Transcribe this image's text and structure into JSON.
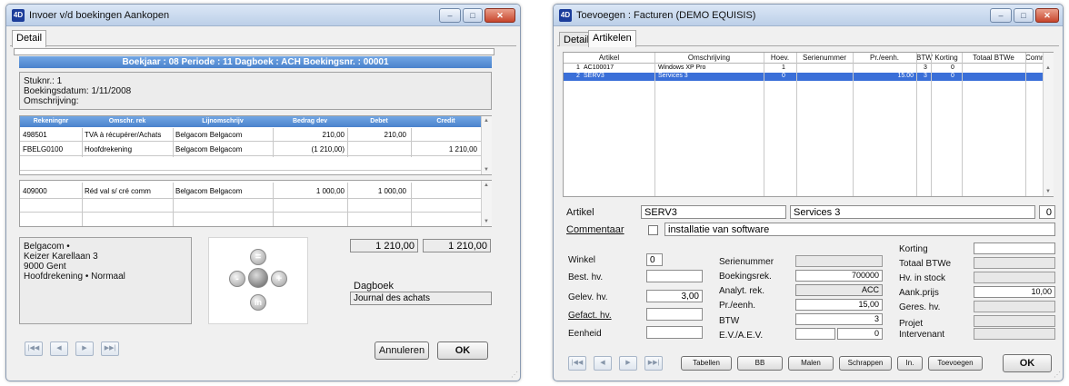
{
  "left_window": {
    "title": "Invoer v/d boekingen Aankopen",
    "tab_detail": "Detail",
    "header_bar": "Boekjaar : 08 Periode : 11 Dagboek : ACH  Boekingsnr. : 00001",
    "info": {
      "stuknr": "Stuknr.: 1",
      "datum": "Boekingsdatum: 1/11/2008",
      "omschrijving": "Omschrijving:"
    },
    "grid_headers": [
      "Rekeningnr",
      "Omschr. rek",
      "Lijnomschrijv",
      "Bedrag dev",
      "Debet",
      "Credit"
    ],
    "grid_rows": [
      {
        "rek": "498501",
        "omschr": "TVA à récupérer/Achats",
        "lijn": "Belgacom Belgacom",
        "dev": "210,00",
        "debet": "210,00",
        "credit": ""
      },
      {
        "rek": "FBELG0100",
        "omschr": "Hoofdrekening",
        "lijn": "Belgacom Belgacom",
        "dev": "(1 210,00)",
        "debet": "",
        "credit": "1 210,00"
      }
    ],
    "grid2_rows": [
      {
        "rek": "409000",
        "omschr": "Réd val s/ cré comm",
        "lijn": "Belgacom Belgacom",
        "dev": "1 000,00",
        "debet": "1 000,00",
        "credit": ""
      }
    ],
    "address": {
      "line1": "Belgacom •",
      "line2": "Keizer Karellaan 3",
      "line3": "9000  Gent",
      "line4": "Hoofdrekening • Normaal"
    },
    "total_debet": "1 210,00",
    "total_credit": "1 210,00",
    "dagboek_label": "Dagboek",
    "dagboek_value": "Journal des achats",
    "dial": {
      "top": "=",
      "left": "-",
      "right": "+",
      "bottom": "in"
    },
    "nav": {
      "first": "|◀◀",
      "prev": "◀",
      "next": "▶",
      "last": "▶▶|"
    },
    "btn_cancel": "Annuleren",
    "btn_ok": "OK"
  },
  "right_window": {
    "title": "Toevoegen : Facturen (DEMO EQUISIS)",
    "tab_detail": "Detail",
    "tab_artikelen": "Artikelen",
    "grid_headers": [
      "Artikel",
      "Omschrijving",
      "Hoev.",
      "Serienummer",
      "Pr./eenh.",
      "BTW",
      "Korting",
      "Totaal BTWe",
      "Comr"
    ],
    "grid_rows": [
      {
        "idx": "1",
        "artikel": "AC100017",
        "omschr": "Windows XP Pro",
        "hoev": "1",
        "serie": "",
        "pr": "",
        "btw": "3",
        "korting": "0",
        "totaal": ""
      },
      {
        "idx": "2",
        "artikel": "SERV3",
        "omschr": "Services 3",
        "hoev": "0",
        "serie": "",
        "pr": "15.00",
        "btw": "3",
        "korting": "0",
        "totaal": ""
      }
    ],
    "artikel_label": "Artikel",
    "artikel_code": "SERV3",
    "artikel_omschr": "Services 3",
    "artikel_count": "0",
    "commentaar_label": "Commentaar",
    "commentaar_value": "installatie van software",
    "left_fields": {
      "winkel_label": "Winkel",
      "winkel_value": "0",
      "best_label": "Best. hv.",
      "gelev_label": "Gelev. hv.",
      "gelev_value": "3,00",
      "gefact_label": "Gefact. hv.",
      "eenheid_label": "Eenheid"
    },
    "mid_fields": {
      "serie_label": "Serienummer",
      "boek_label": "Boekingsrek.",
      "boek_value": "700000",
      "analyt_label": "Analyt. rek.",
      "analyt_value": "ACC",
      "pr_label": "Pr./eenh.",
      "pr_value": "15,00",
      "btw_label": "BTW",
      "btw_value": "3",
      "ev_label": "E.V./A.E.V.",
      "ev_value": "0"
    },
    "right_fields": {
      "korting_label": "Korting",
      "totaal_label": "Totaal BTWe",
      "stock_label": "Hv. in stock",
      "aank_label": "Aank.prijs",
      "aank_value": "10,00",
      "geres_label": "Geres. hv.",
      "projet_label": "Projet",
      "interv_label": "Intervenant"
    },
    "nav": {
      "first": "|◀◀",
      "prev": "◀",
      "next": "▶",
      "last": "▶▶|"
    },
    "buttons": [
      "Tabellen",
      "BB",
      "Malen",
      "Schrappen",
      "In.",
      "Toevoegen"
    ],
    "btn_ok": "OK"
  }
}
